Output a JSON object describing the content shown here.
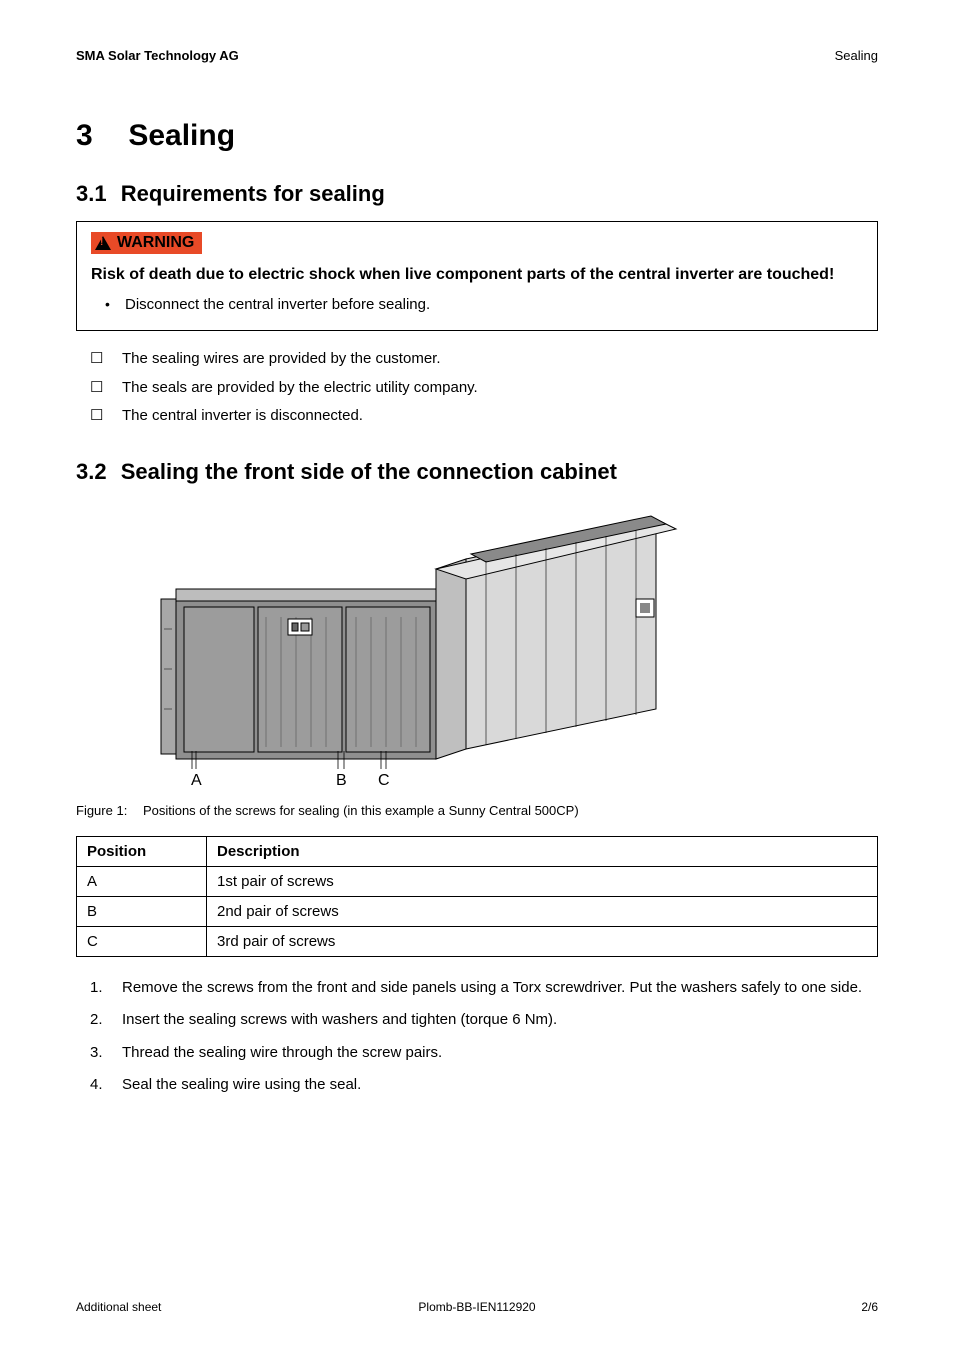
{
  "header": {
    "company": "SMA Solar Technology AG",
    "section": "Sealing"
  },
  "chapter": {
    "number": "3",
    "title": "Sealing"
  },
  "section_3_1": {
    "number": "3.1",
    "title": "Requirements for sealing",
    "warning": {
      "label": "WARNING",
      "heading": "Risk of death due to electric shock when live component parts of the central inverter are touched!",
      "bullets": [
        "Disconnect the central inverter before sealing."
      ]
    },
    "checklist": [
      "The sealing wires are provided by the customer.",
      "The seals are provided by the electric utility company.",
      "The central inverter is disconnected."
    ]
  },
  "section_3_2": {
    "number": "3.2",
    "title": "Sealing the front side of the connection cabinet",
    "figure": {
      "label": "Figure 1:",
      "caption": "Positions of the screws for sealing (in this example a Sunny Central 500CP)",
      "callouts": {
        "a": "A",
        "b": "B",
        "c": "C"
      }
    },
    "table": {
      "headers": {
        "position": "Position",
        "description": "Description"
      },
      "rows": [
        {
          "pos": "A",
          "desc": "1st pair of screws"
        },
        {
          "pos": "B",
          "desc": "2nd pair of screws"
        },
        {
          "pos": "C",
          "desc": "3rd pair of screws"
        }
      ]
    },
    "steps": [
      "Remove the screws from the front and side panels using a Torx screwdriver. Put the washers safely to one side.",
      "Insert the sealing screws with washers and tighten (torque 6 Nm).",
      "Thread the sealing wire through the screw pairs.",
      "Seal the sealing wire using the seal."
    ]
  },
  "footer": {
    "left": "Additional sheet",
    "center": "Plomb-BB-IEN112920",
    "right": "2/6"
  }
}
